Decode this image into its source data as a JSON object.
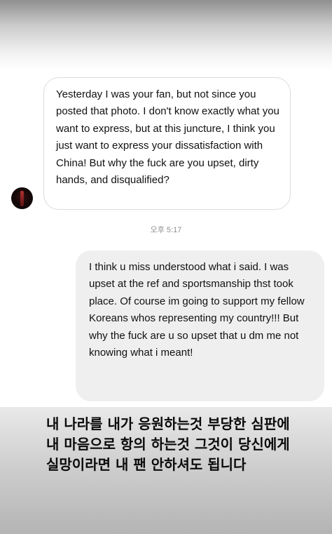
{
  "conversation": {
    "incoming_message": "Yesterday I was your fan, but not since you posted that photo. I don't know exactly what you want to express, but at this juncture, I think you just want to express your dissatisfaction with China! But why the fuck are you upset, dirty hands, and disqualified?",
    "timestamp": "오후 5:17",
    "outgoing_message": "I think u miss understood what i said. I was upset at the ref and sportsmanship thst took place. Of course im going to support my fellow Koreans whos representing my country!!! But why the fuck are u so upset that u dm me not knowing what i meant!"
  },
  "story_caption": {
    "text": "내 나라를 내가 응원하는것 부당한 심판에 내 마음으로 항의 하는것 그것이 당신에게 실망이라면 내 팬 안하셔도 됩니다"
  },
  "colors": {
    "outgoing_bubble": "#efefef",
    "incoming_bubble_border": "#dcdcdc",
    "timestamp_text": "#8e8e8e"
  }
}
